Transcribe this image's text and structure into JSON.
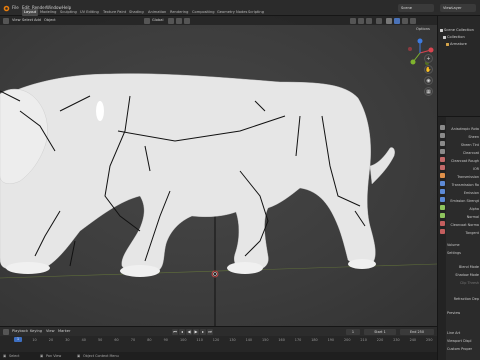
{
  "topbar": {
    "menus": [
      "File",
      "Edit",
      "Render",
      "Window",
      "Help"
    ],
    "workspaces": [
      "Layout",
      "Modeling",
      "Sculpting",
      "UV Editing",
      "Texture Paint",
      "Shading",
      "Animation",
      "Rendering",
      "Compositing",
      "Geometry Nodes",
      "Scripting"
    ],
    "active_workspace": "Layout",
    "scene": "Scene",
    "view_layer": "ViewLayer"
  },
  "viewport": {
    "header_items": [
      "View",
      "Select",
      "Add",
      "Object"
    ],
    "transform_orientation": "Global",
    "options_label": "Options",
    "background_color": "#3c3c3c",
    "mesh_color": "#e9e9e9",
    "bone_color": "#111111"
  },
  "outliner": {
    "rows": [
      {
        "label": "Scene Collection",
        "icon": "collection-icon"
      },
      {
        "label": "Collection",
        "icon": "collection-icon"
      },
      {
        "label": "Armature",
        "icon": "armature-icon"
      }
    ]
  },
  "properties": {
    "rows": [
      "Anisotropic Rota",
      "Sheen",
      "Sheen Tint",
      "Clearcoat",
      "Clearcoat Rough",
      "IOR",
      "Transmission",
      "Transmission Ro",
      "Emission",
      "Emission Strengt",
      "Alpha",
      "Normal",
      "Clearcoat Norma",
      "Tangent",
      "Volume",
      "Settings",
      "Blend Mode",
      "Shadow Mode",
      "Clip Thresh",
      "Refraction Dep",
      "Preview",
      "Line Art",
      "Viewport Displ",
      "Custom Proper"
    ]
  },
  "timeline": {
    "menus": [
      "Playback",
      "Keying",
      "View",
      "Marker"
    ],
    "current_frame": "1",
    "start_label": "Start",
    "start_value": "1",
    "end_label": "End",
    "end_value": "250",
    "ticks": [
      "0",
      "10",
      "20",
      "30",
      "40",
      "50",
      "60",
      "70",
      "80",
      "90",
      "100",
      "110",
      "120",
      "130",
      "140",
      "150",
      "160",
      "170",
      "180",
      "190",
      "200",
      "210",
      "220",
      "230",
      "240",
      "250"
    ]
  },
  "statusbar": {
    "items": [
      "Select",
      "Pan View",
      "Object Context Menu"
    ]
  }
}
